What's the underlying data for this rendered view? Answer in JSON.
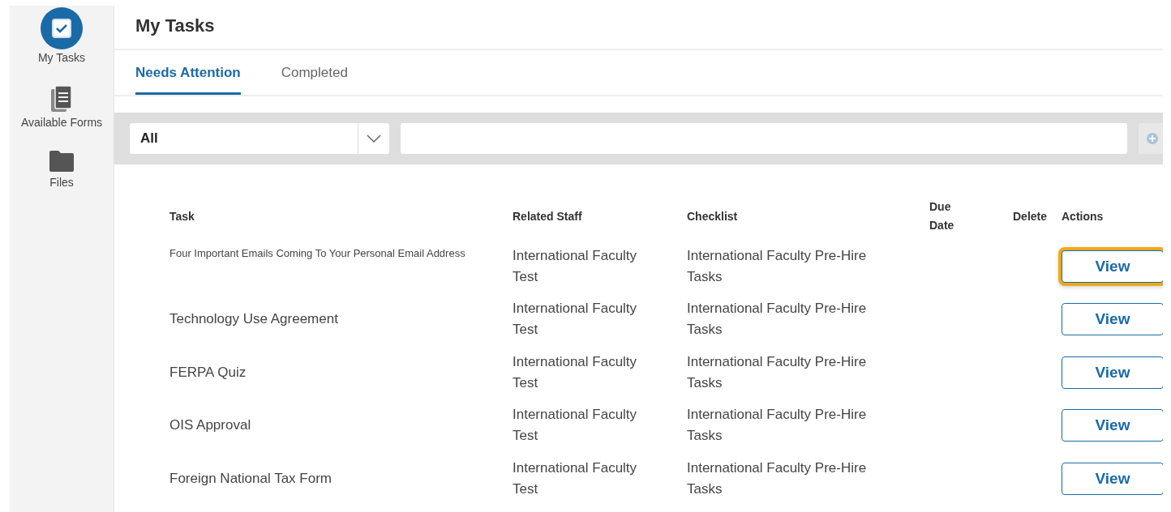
{
  "sidebar": {
    "items": [
      {
        "label": "My Tasks",
        "kind": "tasks",
        "selected": true
      },
      {
        "label": "Available Forms",
        "kind": "forms",
        "selected": false
      },
      {
        "label": "Files",
        "kind": "files",
        "selected": false
      }
    ]
  },
  "header": {
    "title": "My Tasks"
  },
  "tabs": [
    {
      "label": "Needs Attention",
      "selected": true
    },
    {
      "label": "Completed",
      "selected": false
    }
  ],
  "filter": {
    "value": "All"
  },
  "table": {
    "columns": [
      "Task",
      "Related Staff",
      "Checklist",
      "Due Date",
      "Delete",
      "Actions"
    ],
    "rows": [
      {
        "task": "Four Important Emails Coming To Your Personal Email Address",
        "small": true,
        "staff": "International Faculty Test",
        "checklist": "International Faculty Pre-Hire Tasks",
        "action": "View",
        "focused": true
      },
      {
        "task": "Technology Use Agreement",
        "small": false,
        "staff": "International Faculty Test",
        "checklist": "International Faculty Pre-Hire Tasks",
        "action": "View",
        "focused": false
      },
      {
        "task": "FERPA Quiz",
        "small": false,
        "staff": "International Faculty Test",
        "checklist": "International Faculty Pre-Hire Tasks",
        "action": "View",
        "focused": false
      },
      {
        "task": "OIS Approval",
        "small": false,
        "staff": "International Faculty Test",
        "checklist": "International Faculty Pre-Hire Tasks",
        "action": "View",
        "focused": false
      },
      {
        "task": "Foreign National Tax Form",
        "small": false,
        "staff": "International Faculty Test",
        "checklist": "International Faculty Pre-Hire Tasks",
        "action": "View",
        "focused": false
      }
    ]
  }
}
